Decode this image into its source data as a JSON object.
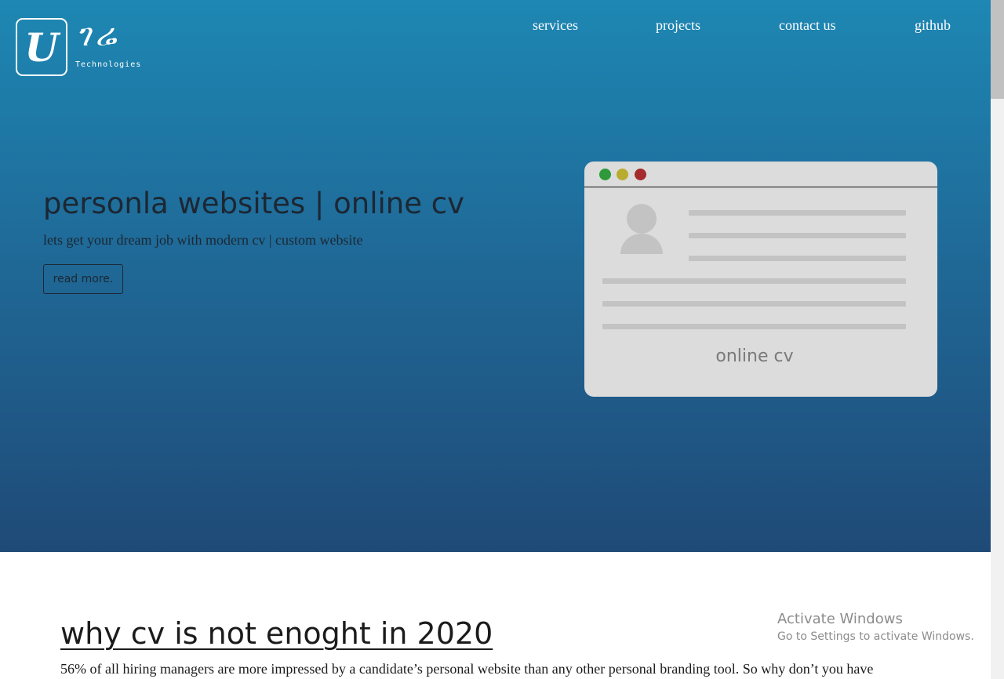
{
  "logo": {
    "mark": "U",
    "letters": "ገሬ",
    "subtitle": "Technologies"
  },
  "nav": {
    "items": [
      {
        "label": "services"
      },
      {
        "label": "projects"
      },
      {
        "label": "contact us"
      },
      {
        "label": "github"
      }
    ]
  },
  "hero": {
    "title": "personla websites | online cv",
    "subtitle": "lets get your dream job with modern cv | custom website",
    "button_label": "read more.",
    "mockup": {
      "label": "online cv",
      "dot_colors": [
        "#2f9a3b",
        "#b8ac2e",
        "#a52c2c"
      ]
    }
  },
  "section": {
    "title": "why cv is not enoght in 2020",
    "text": "56% of all hiring managers are more impressed by a candidate’s personal website than any other personal branding tool. So why don’t you have"
  },
  "watermark": {
    "title": "Activate Windows",
    "subtitle": "Go to Settings to activate Windows."
  },
  "colors": {
    "hero_top": "#1e87b3",
    "hero_bottom": "#1f4a77",
    "text_dark": "#1c2733"
  }
}
